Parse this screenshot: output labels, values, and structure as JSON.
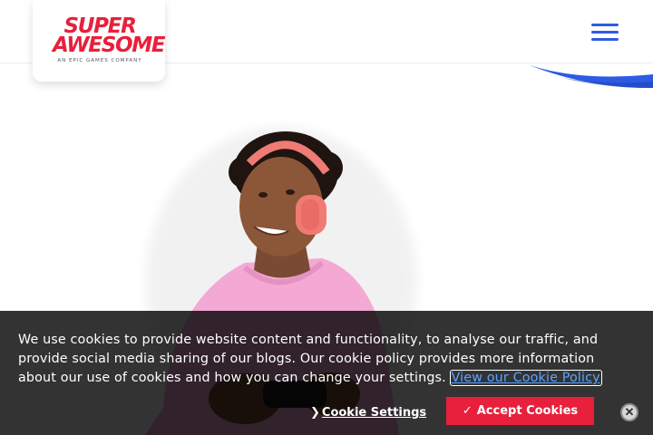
{
  "header": {
    "logo_line1": "SUPER",
    "logo_line2": "AWESOME",
    "logo_tagline": "AN EPIC GAMES COMPANY",
    "menu_icon": "hamburger-menu-icon"
  },
  "hero": {
    "image": "young-man-with-pink-headphones-photo"
  },
  "cookie_banner": {
    "message": "We use cookies to provide website content and functionality, to analyse our traffic, and provide social media sharing of our blogs. Our cookie policy provides more information about our use of cookies and how you can change your settings.",
    "policy_link": "View our Cookie Policy",
    "settings_chevron": "❯",
    "settings_label": "Cookie Settings",
    "accept_check": "✓",
    "accept_label": "Accept Cookies",
    "close_glyph": "✕"
  },
  "colors": {
    "brand_red": "#e8203b",
    "brand_blue": "#2d5be3",
    "link_blue": "#5aa5ff"
  }
}
